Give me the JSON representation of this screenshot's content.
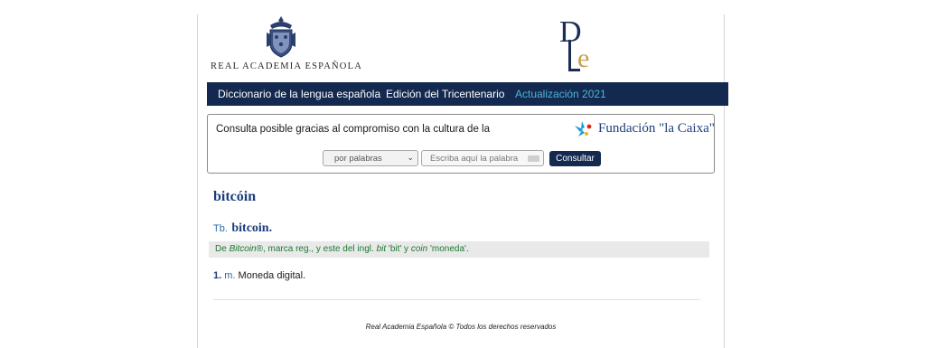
{
  "header": {
    "rae_name": "REAL ACADEMIA ESPAÑOLA",
    "dle_logo_icon": "dle-monogram-icon",
    "crest_icon": "rae-crest-icon"
  },
  "nav": {
    "items": [
      {
        "label": "Diccionario de la lengua española"
      },
      {
        "label": "Edición del Tricentenario"
      },
      {
        "label": "Actualización 2021"
      }
    ]
  },
  "search": {
    "sponsor_text": "Consulta posible gracias al compromiso con la cultura de la",
    "sponsor_name": "Fundación \"la Caixa\"",
    "mode_selected": "por palabras",
    "input_placeholder": "Escriba aquí la palabra",
    "submit_label": "Consultar"
  },
  "entry": {
    "headword": "bitcóin",
    "tb_label": "Tb.",
    "tb_word": "bitcoin.",
    "etymology": {
      "p1": "De ",
      "i1": "Bitcoin",
      "p2": "®, marca reg., y este del ingl. ",
      "i2": "bit",
      "p3": " 'bit' y ",
      "i3": "coin",
      "p4": " 'moneda'."
    },
    "definitions": [
      {
        "num": "1.",
        "abbr": "m.",
        "text": "Moneda digital."
      }
    ]
  },
  "footer": {
    "text": "Real Academia Española © Todos los derechos reservados"
  },
  "colors": {
    "navy": "#13294f",
    "accent_blue": "#4fb3d6",
    "headword_blue": "#1c3d7a",
    "etymology_green": "#1b7a30"
  }
}
